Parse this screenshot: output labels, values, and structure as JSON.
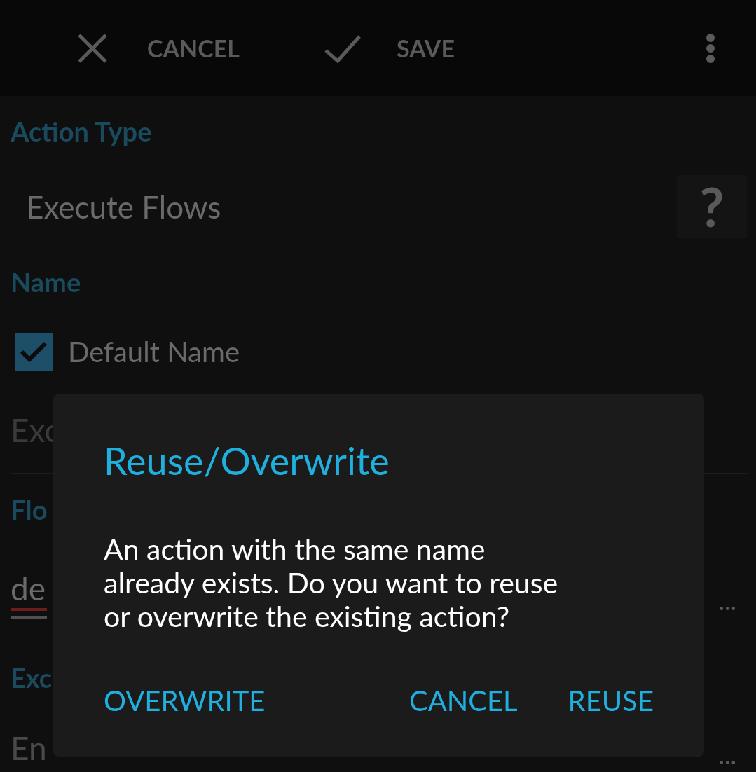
{
  "toolbar": {
    "cancel": "CANCEL",
    "save": "SAVE"
  },
  "sections": [
    {
      "kind": "label",
      "text": "Action Type"
    },
    {
      "kind": "value",
      "text": "Execute Flows",
      "help": "?"
    },
    {
      "kind": "label",
      "text": "Name"
    },
    {
      "kind": "checkbox",
      "text": "Default Name",
      "checked": true
    },
    {
      "kind": "input",
      "text": "Exc"
    },
    {
      "kind": "label",
      "text": "Flo"
    },
    {
      "kind": "error-input",
      "text": "de",
      "more": "..."
    },
    {
      "kind": "label",
      "text": "Exc"
    },
    {
      "kind": "input-more",
      "text": "En",
      "more": "..."
    }
  ],
  "dialog": {
    "title": "Reuse/Overwrite",
    "message": "An action with the same name already exists. Do you want to reuse or overwrite the existing action?",
    "buttons": [
      {
        "label": "OVERWRITE"
      },
      {
        "label": "CANCEL"
      },
      {
        "label": "REUSE"
      }
    ]
  }
}
